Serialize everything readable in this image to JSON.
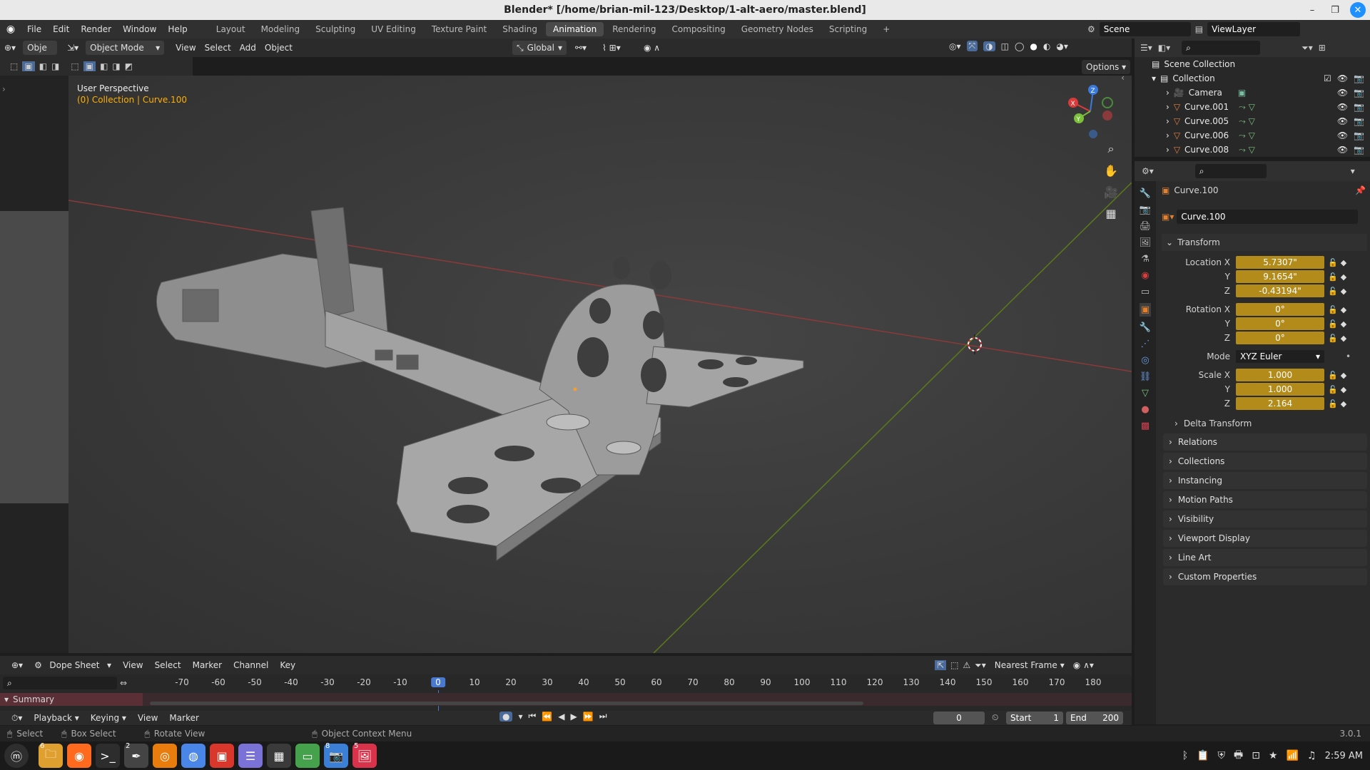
{
  "window": {
    "title": "Blender* [/home/brian-mil-123/Desktop/1-alt-aero/master.blend]"
  },
  "menubar": {
    "menus": [
      "File",
      "Edit",
      "Render",
      "Window",
      "Help"
    ],
    "workspaces": [
      "Layout",
      "Modeling",
      "Sculpting",
      "UV Editing",
      "Texture Paint",
      "Shading",
      "Animation",
      "Rendering",
      "Compositing",
      "Geometry Nodes",
      "Scripting"
    ],
    "active_workspace": "Animation",
    "scene": "Scene",
    "view_layer": "ViewLayer"
  },
  "viewport_header": {
    "truncated_label": "Obje",
    "mode": "Object Mode",
    "menus": [
      "View",
      "Select",
      "Add",
      "Object"
    ],
    "orientation": "Global",
    "options": "Options"
  },
  "viewport": {
    "perspective": "User Perspective",
    "context": "(0) Collection | Curve.100",
    "gizmo_axes": [
      "X",
      "Y",
      "Z"
    ]
  },
  "outliner": {
    "root": "Scene Collection",
    "collection": "Collection",
    "items": [
      "Camera",
      "Curve.001",
      "Curve.005",
      "Curve.006",
      "Curve.008"
    ]
  },
  "properties": {
    "object_name": "Curve.100",
    "object_field": "Curve.100",
    "transform_title": "Transform",
    "location_label": "Location X",
    "rotation_label": "Rotation X",
    "scale_label": "Scale X",
    "y_label": "Y",
    "z_label": "Z",
    "location": [
      "5.7307\"",
      "9.1654\"",
      "-0.43194\""
    ],
    "rotation": [
      "0°",
      "0°",
      "0°"
    ],
    "mode_label": "Mode",
    "mode": "XYZ Euler",
    "scale": [
      "1.000",
      "1.000",
      "2.164"
    ],
    "delta_transform": "Delta Transform",
    "panels": [
      "Relations",
      "Collections",
      "Instancing",
      "Motion Paths",
      "Visibility",
      "Viewport Display",
      "Line Art",
      "Custom Properties"
    ]
  },
  "dopesheet": {
    "editor": "Dope Sheet",
    "menus": [
      "View",
      "Select",
      "Marker",
      "Channel",
      "Key"
    ],
    "snapping": "Nearest Frame",
    "ticks": [
      "-70",
      "-60",
      "-50",
      "-40",
      "-30",
      "-20",
      "-10",
      "0",
      "10",
      "20",
      "30",
      "40",
      "50",
      "60",
      "70",
      "80",
      "90",
      "100",
      "110",
      "120",
      "130",
      "140",
      "150",
      "160",
      "170",
      "180"
    ],
    "current_frame": "0",
    "summary": "Summary"
  },
  "playback": {
    "menus": [
      "Playback",
      "Keying",
      "View",
      "Marker"
    ],
    "frame": "0",
    "start_label": "Start",
    "start": "1",
    "end_label": "End",
    "end": "200"
  },
  "statusbar": {
    "hints": [
      "Select",
      "Box Select",
      "Rotate View",
      "Object Context Menu"
    ],
    "version": "3.0.1"
  },
  "taskbar": {
    "clock": "2:59 AM",
    "apps": [
      {
        "name": "files",
        "color": "#e0a030",
        "badge": "6"
      },
      {
        "name": "firefox",
        "color": "#ff6a1f"
      },
      {
        "name": "terminal",
        "color": "#2d2d2d"
      },
      {
        "name": "inkscape",
        "color": "#444",
        "badge": "2"
      },
      {
        "name": "blender",
        "color": "#e87d0d"
      },
      {
        "name": "chromium",
        "color": "#4a86e8"
      },
      {
        "name": "app-red",
        "color": "#d9372b"
      },
      {
        "name": "text-editor",
        "color": "#7a72d6"
      },
      {
        "name": "calculator",
        "color": "#3a3a3a"
      },
      {
        "name": "terminal-2",
        "color": "#45a14b"
      },
      {
        "name": "screenshot",
        "color": "#3b7fd6",
        "badge": "8"
      },
      {
        "name": "image-viewer",
        "color": "#d8334a",
        "badge": "5"
      }
    ]
  }
}
